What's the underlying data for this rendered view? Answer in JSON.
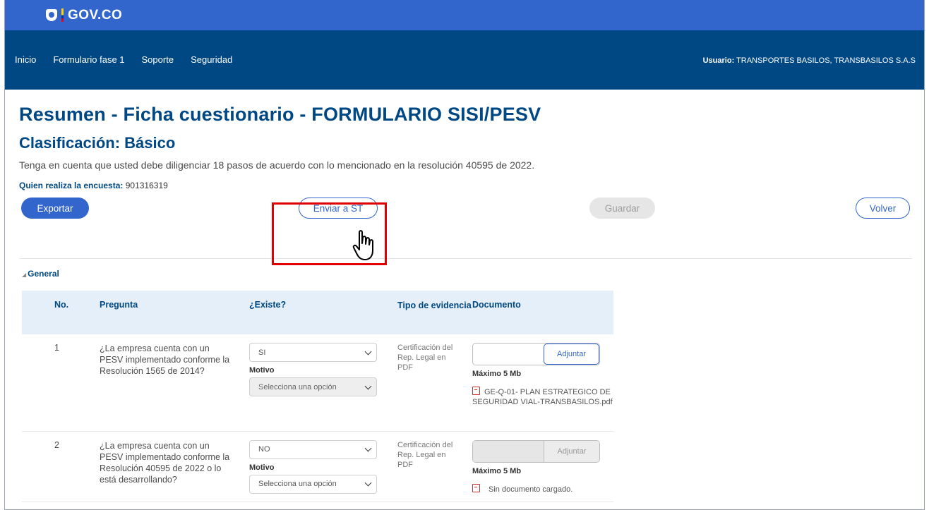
{
  "gov_bar": {
    "logo_text": "GOV.CO"
  },
  "nav": {
    "items": [
      "Inicio",
      "Formulario fase 1",
      "Soporte",
      "Seguridad"
    ],
    "user_label": "Usuario:",
    "user_value": " TRANSPORTES BASILOS, TRANSBASILOS S.A.S"
  },
  "page": {
    "title": "Resumen - Ficha cuestionario - FORMULARIO SISI/PESV",
    "subtitle": "Clasificación: Básico",
    "note": "Tenga en cuenta que usted debe diligenciar 18 pasos de acuerdo con lo mencionado en la resolución 40595 de 2022.",
    "quien_label": "Quien realiza la encuesta:",
    "quien_value": " 901316319"
  },
  "buttons": {
    "exportar": "Exportar",
    "enviar": "Enviar a ST",
    "guardar": "Guardar",
    "volver": "Volver"
  },
  "section": {
    "label": "General"
  },
  "table": {
    "headers": {
      "no": "No.",
      "pregunta": "Pregunta",
      "existe": "¿Existe?",
      "tipo": "Tipo de evidencia",
      "documento": "Documento"
    },
    "rows": [
      {
        "no": "1",
        "pregunta": "¿La empresa cuenta con un PESV implementado conforme la Resolución 1565 de 2014?",
        "existe": "SI",
        "motivo_label": "Motivo",
        "motivo_placeholder": "Selecciona una opción",
        "tipo": "Certificación del Rep. Legal en PDF",
        "adjuntar": "Adjuntar",
        "maximo": "Máximo 5 Mb",
        "documento": "GE-Q-01- PLAN ESTRATEGICO DE SEGURIDAD VIAL-TRANSBASILOS.pdf"
      },
      {
        "no": "2",
        "pregunta": "¿La empresa cuenta con un PESV implementado conforme la Resolución 40595 de 2022 o lo está desarrollando?",
        "existe": "NO",
        "motivo_label": "Motivo",
        "motivo_placeholder": "Selecciona una opción",
        "tipo": "Certificación del Rep. Legal en PDF",
        "adjuntar": "Adjuntar",
        "maximo": "Máximo 5 Mb",
        "documento": "Sin documento cargado."
      }
    ]
  },
  "colors": {
    "gov_blue": "#3366cc",
    "nav_blue": "#004884",
    "highlight_red": "#e00000"
  }
}
